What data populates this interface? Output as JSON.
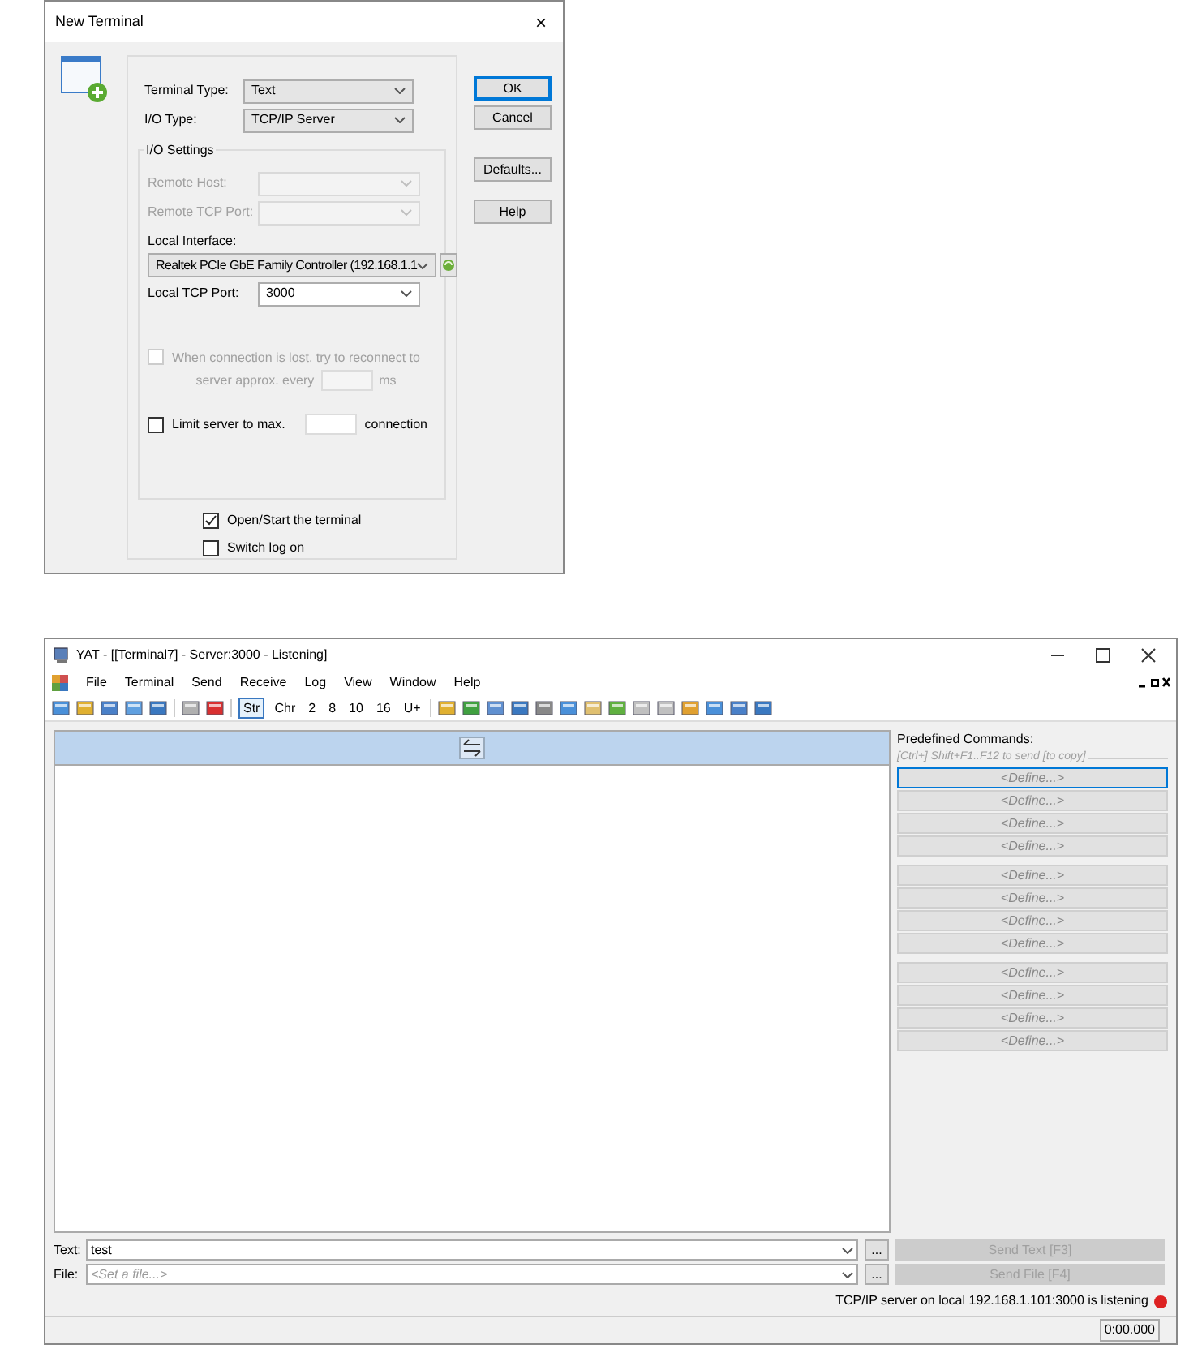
{
  "dialog": {
    "title": "New Terminal",
    "close": "×",
    "terminal_type": {
      "label": "Terminal Type:",
      "value": "Text"
    },
    "io_type": {
      "label": "I/O Type:",
      "value": "TCP/IP Server"
    },
    "io_settings": {
      "title": "I/O Settings",
      "remote_host": {
        "label": "Remote Host:",
        "disabled": true
      },
      "remote_tcp_port": {
        "label": "Remote TCP Port:",
        "disabled": true
      },
      "local_interface": {
        "label": "Local Interface:",
        "value": "Realtek PCIe GbE Family Controller (192.168.1.1"
      },
      "local_tcp_port": {
        "label": "Local TCP Port:",
        "value": "3000"
      },
      "reconnect": {
        "label": "When connection is lost, try to reconnect to",
        "label_2": "server approx. every",
        "unit": "ms",
        "checked": false,
        "disabled": true
      },
      "limit": {
        "label": "Limit server to max.",
        "unit": "connection",
        "checked": false,
        "disabled": false
      }
    },
    "options": [
      {
        "label": "Open/Start the terminal",
        "checked": true
      },
      {
        "label": "Switch log on",
        "checked": false
      }
    ],
    "buttons": [
      {
        "label": "OK",
        "default": true
      },
      {
        "label": "Cancel",
        "default": false
      },
      {
        "label": "Defaults...",
        "default": false
      },
      {
        "label": "Help",
        "default": false
      }
    ]
  },
  "main": {
    "title": "YAT - [[Terminal7] - Server:3000 - Listening]",
    "menu": [
      "File",
      "Terminal",
      "Send",
      "Receive",
      "Log",
      "View",
      "Window",
      "Help"
    ],
    "radix": [
      {
        "label": "Str",
        "selected": true
      },
      {
        "label": "Chr",
        "selected": false
      },
      {
        "label": "2",
        "selected": false
      },
      {
        "label": "8",
        "selected": false
      },
      {
        "label": "10",
        "selected": false
      },
      {
        "label": "16",
        "selected": false
      },
      {
        "label": "U+",
        "selected": false
      }
    ],
    "predefined": {
      "title": "Predefined Commands:",
      "hint": "[Ctrl+] Shift+F1..F12 to send [to copy]",
      "groups": [
        [
          {
            "label": "<Define...>",
            "focused": true
          },
          {
            "label": "<Define...>",
            "focused": false
          },
          {
            "label": "<Define...>",
            "focused": false
          },
          {
            "label": "<Define...>",
            "focused": false
          }
        ],
        [
          {
            "label": "<Define...>",
            "focused": false
          },
          {
            "label": "<Define...>",
            "focused": false
          },
          {
            "label": "<Define...>",
            "focused": false
          },
          {
            "label": "<Define...>",
            "focused": false
          }
        ],
        [
          {
            "label": "<Define...>",
            "focused": false
          },
          {
            "label": "<Define...>",
            "focused": false
          },
          {
            "label": "<Define...>",
            "focused": false
          },
          {
            "label": "<Define...>",
            "focused": false
          }
        ]
      ]
    },
    "text_row": {
      "label": "Text:",
      "value": "test",
      "browse": "...",
      "send": {
        "label": "Send Text [F3]",
        "disabled": true
      }
    },
    "file_row": {
      "label": "File:",
      "placeholder": "<Set a file...>",
      "browse": "...",
      "send": {
        "label": "Send File [F4]",
        "disabled": true
      }
    },
    "status": {
      "message": "TCP/IP server on local 192.168.1.101:3000 is listening",
      "listening": true
    },
    "timer": "0:00.000"
  }
}
